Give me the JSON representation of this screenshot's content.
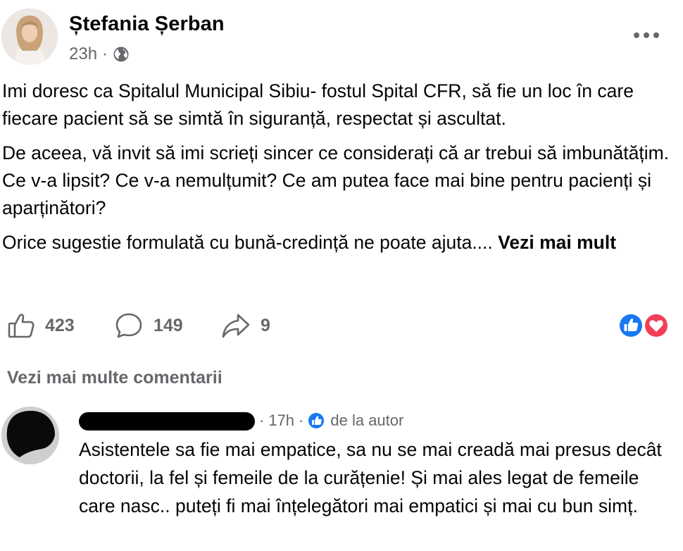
{
  "post": {
    "author": "Ștefania Șerban",
    "time": "23h",
    "dot": "·",
    "privacy_icon": "globe-icon",
    "paragraphs": [
      "Imi doresc ca Spitalul Municipal Sibiu- fostul Spital CFR,  să fie un loc în care fiecare pacient să se simtă în siguranță, respectat și ascultat.",
      "De aceea, vă invit să imi scrieți sincer ce considerați că ar trebui să imbunătățim. Ce v-a lipsit? Ce v-a nemulțumit? Ce am putea face mai bine pentru pacienți și aparținători?",
      "Orice sugestie formulată cu bună-credință ne poate ajuta...."
    ],
    "see_more": "Vezi mai mult"
  },
  "actions": {
    "like_count": "423",
    "comment_count": "149",
    "share_count": "9",
    "reactions": [
      "like",
      "love"
    ]
  },
  "comments": {
    "view_more": "Vezi mai multe comentarii",
    "items": [
      {
        "time": "17h",
        "dot": "·",
        "badge": "de la autor",
        "text": "Asistentele sa fie mai empatice, sa nu se mai creadă mai presus decât doctorii, la fel și femeile de la curățenie! Și mai ales legat de femeile care nasc.. puteți fi mai înțelegători mai empatici și mai cu bun simț."
      }
    ]
  },
  "colors": {
    "text": "#050505",
    "secondary": "#65676b",
    "like_blue": "#1877f2",
    "love_red": "#f33e58"
  }
}
